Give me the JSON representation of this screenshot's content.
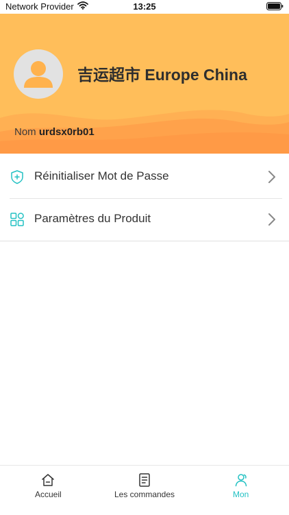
{
  "status_bar": {
    "carrier": "Network Provider",
    "time": "13:25"
  },
  "profile": {
    "store_name": "吉运超市 Europe China",
    "nom_label": "Nom",
    "nom_value": "urdsx0rb01"
  },
  "menu": {
    "items": [
      {
        "label": "Réinitialiser Mot de Passe",
        "icon": "shield-plus-icon"
      },
      {
        "label": "Paramètres du Produit",
        "icon": "grid-apps-icon"
      }
    ]
  },
  "tabbar": {
    "tabs": [
      {
        "label": "Accueil",
        "icon": "home-icon",
        "active": false
      },
      {
        "label": "Les commandes",
        "icon": "document-icon",
        "active": false
      },
      {
        "label": "Mon",
        "icon": "user-icon",
        "active": true
      }
    ]
  },
  "colors": {
    "header": "#FFBE5A",
    "wave": "#FFA64D",
    "accent": "#22C1C3"
  }
}
